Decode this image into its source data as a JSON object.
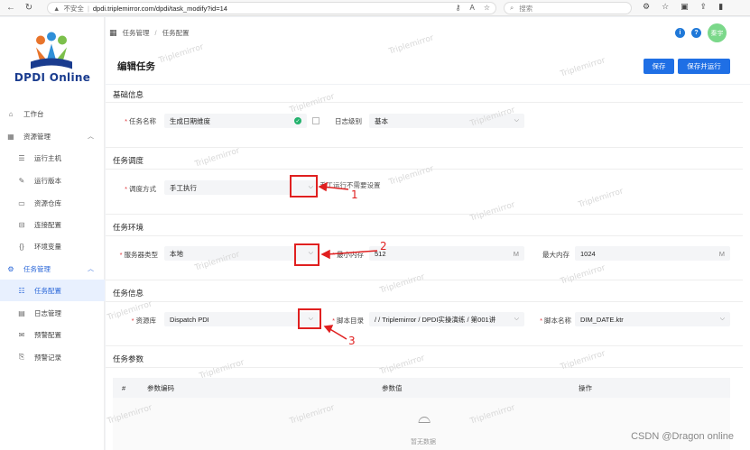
{
  "browser": {
    "security": "不安全",
    "url": "dpdi.triplemirror.com/dpdi/task_modify?id=14",
    "search_placeholder": "搜索"
  },
  "brand": {
    "name": "DPDI Online"
  },
  "sidebar": {
    "items": [
      {
        "label": "工作台",
        "icon": "desktop-icon"
      },
      {
        "label": "资源管理",
        "icon": "grid-icon"
      },
      {
        "label": "运行主机",
        "icon": "server-icon"
      },
      {
        "label": "运行版本",
        "icon": "edit-icon"
      },
      {
        "label": "资源仓库",
        "icon": "folder-icon"
      },
      {
        "label": "连接配置",
        "icon": "link-icon"
      },
      {
        "label": "环境变量",
        "icon": "braces-icon"
      },
      {
        "label": "任务管理",
        "icon": "gear-icon"
      },
      {
        "label": "任务配置",
        "icon": "list-icon"
      },
      {
        "label": "日志管理",
        "icon": "log-icon"
      },
      {
        "label": "预警配置",
        "icon": "mail-icon"
      },
      {
        "label": "预警记录",
        "icon": "record-icon"
      }
    ]
  },
  "breadcrumb": {
    "level1": "任务管理",
    "level2": "任务配置"
  },
  "header": {
    "user": "秦宇"
  },
  "page": {
    "title": "编辑任务",
    "save_label": "保存",
    "save_run_label": "保存并运行"
  },
  "basic": {
    "title": "基础信息",
    "task_name_label": "任务名称",
    "task_name_value": "生成日期维度",
    "log_level_label": "日志级别",
    "log_level_value": "基本"
  },
  "schedule": {
    "title": "任务调度",
    "method_label": "调度方式",
    "method_value": "手工执行",
    "hint": "手工运行不需要设置"
  },
  "env": {
    "title": "任务环境",
    "server_type_label": "服务器类型",
    "server_type_value": "本地",
    "min_mem_label": "最小内存",
    "min_mem_value": "512",
    "max_mem_label": "最大内存",
    "max_mem_value": "1024",
    "unit": "M"
  },
  "info": {
    "title": "任务信息",
    "repo_label": "资源库",
    "repo_value": "Dispatch PDI",
    "dir_label": "脚本目录",
    "dir_value": "/ / Triplemirror / DPDI实操演练 / 第001讲",
    "script_label": "脚本名称",
    "script_value": "DIM_DATE.ktr"
  },
  "params": {
    "title": "任务参数",
    "col_index": "#",
    "col_code": "参数编码",
    "col_value": "参数值",
    "col_action": "操作",
    "empty": "暂无数据"
  },
  "annotations": {
    "n1": "1",
    "n2": "2",
    "n3": "3",
    "color": "#e02020"
  },
  "watermark": "Triplemirror",
  "footer_mark": "CSDN @Dragon online"
}
